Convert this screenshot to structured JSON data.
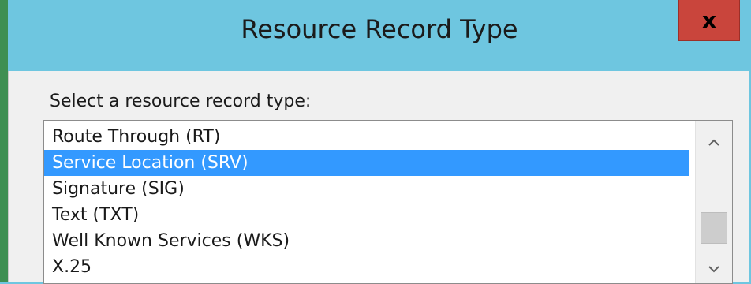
{
  "dialog": {
    "title": "Resource Record Type",
    "close_label": "x"
  },
  "prompt": "Select a resource record type:",
  "record_types": {
    "items": [
      {
        "label": "Route Through (RT)",
        "selected": false
      },
      {
        "label": "Service Location (SRV)",
        "selected": true
      },
      {
        "label": "Signature (SIG)",
        "selected": false
      },
      {
        "label": "Text (TXT)",
        "selected": false
      },
      {
        "label": "Well Known Services (WKS)",
        "selected": false
      },
      {
        "label": "X.25",
        "selected": false
      }
    ]
  },
  "scrollbar": {
    "up_icon": "chevron-up-icon",
    "down_icon": "chevron-down-icon"
  },
  "colors": {
    "titlebar": "#6ec6e0",
    "close_button": "#c9453c",
    "selection": "#3399ff",
    "body": "#f0f0f0"
  }
}
